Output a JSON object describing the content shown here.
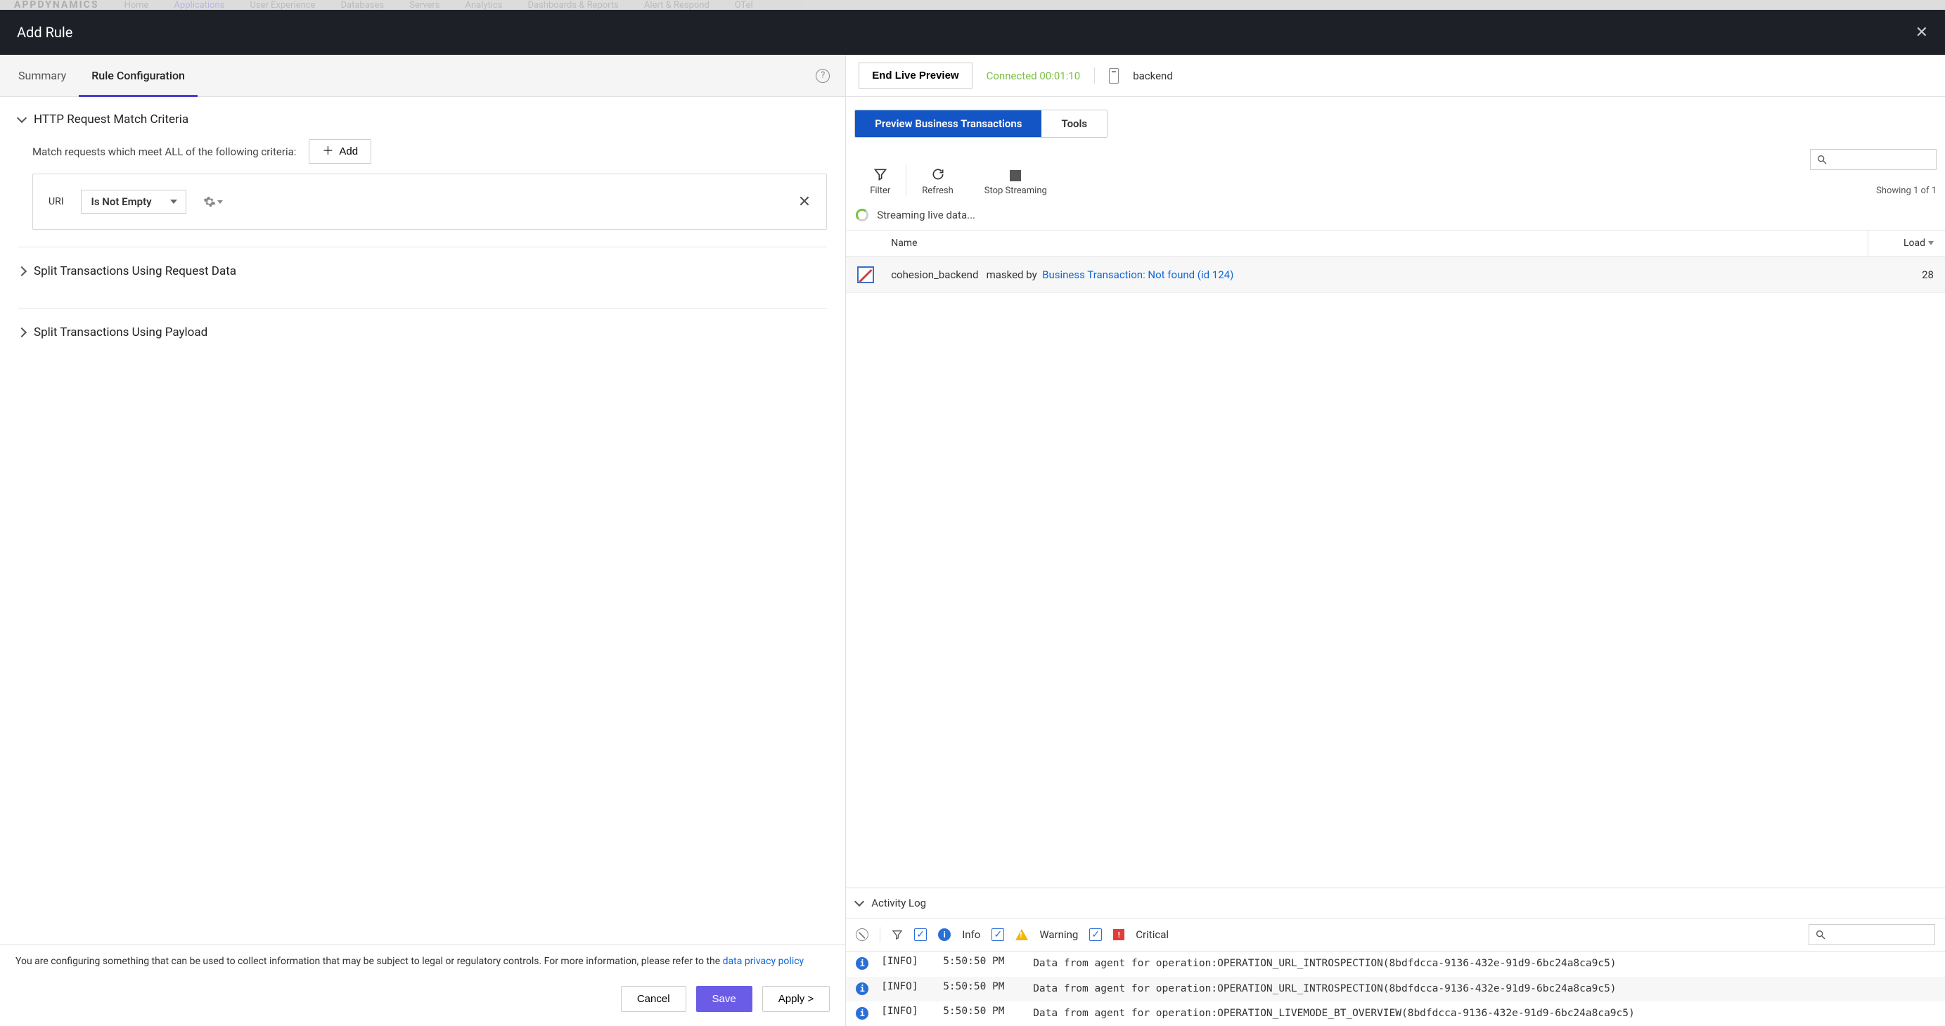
{
  "brand": "APPDYNAMICS",
  "top_nav": {
    "items": [
      "Home",
      "Applications",
      "User Experience",
      "Databases",
      "Servers",
      "Analytics",
      "Dashboards & Reports",
      "Alert & Respond",
      "OTel"
    ],
    "active_index": 1
  },
  "modal": {
    "title": "Add Rule",
    "tabs": {
      "summary": "Summary",
      "rule_config": "Rule Configuration"
    },
    "section_http": "HTTP Request Match Criteria",
    "match_text": "Match requests which meet ALL of the following criteria:",
    "add_label": "Add",
    "criteria": {
      "field": "URI",
      "operator": "Is Not Empty"
    },
    "section_split_request": "Split Transactions Using Request Data",
    "section_split_payload": "Split Transactions Using Payload",
    "notice_pre": "You are configuring something that can be used to collect information that may be subject to legal or regulatory controls. For more information, please refer to the ",
    "notice_link": "data privacy policy",
    "buttons": {
      "cancel": "Cancel",
      "save": "Save",
      "apply": "Apply >"
    }
  },
  "preview": {
    "end_btn": "End Live Preview",
    "connected_label": "Connected",
    "connected_time": "00:01:10",
    "backend": "backend",
    "tabs": {
      "preview": "Preview Business Transactions",
      "tools": "Tools"
    },
    "tools": {
      "filter": "Filter",
      "refresh": "Refresh",
      "stop": "Stop Streaming"
    },
    "showing": "Showing 1 of 1",
    "streaming": "Streaming live data...",
    "columns": {
      "name": "Name",
      "load": "Load"
    },
    "rows": [
      {
        "name": "cohesion_backend",
        "masked_prefix": "masked by",
        "masked_link": "Business Transaction: Not found (id 124)",
        "load": "28"
      }
    ]
  },
  "activity": {
    "title": "Activity Log",
    "labels": {
      "info": "Info",
      "warning": "Warning",
      "critical": "Critical"
    },
    "logs": [
      {
        "level": "[INFO]",
        "time": "5:50:50 PM",
        "msg": "Data from agent for operation:OPERATION_URL_INTROSPECTION(8bdfdcca-9136-432e-91d9-6bc24a8ca9c5)"
      },
      {
        "level": "[INFO]",
        "time": "5:50:50 PM",
        "msg": "Data from agent for operation:OPERATION_URL_INTROSPECTION(8bdfdcca-9136-432e-91d9-6bc24a8ca9c5)"
      },
      {
        "level": "[INFO]",
        "time": "5:50:50 PM",
        "msg": "Data from agent for operation:OPERATION_LIVEMODE_BT_OVERVIEW(8bdfdcca-9136-432e-91d9-6bc24a8ca9c5)"
      }
    ]
  }
}
